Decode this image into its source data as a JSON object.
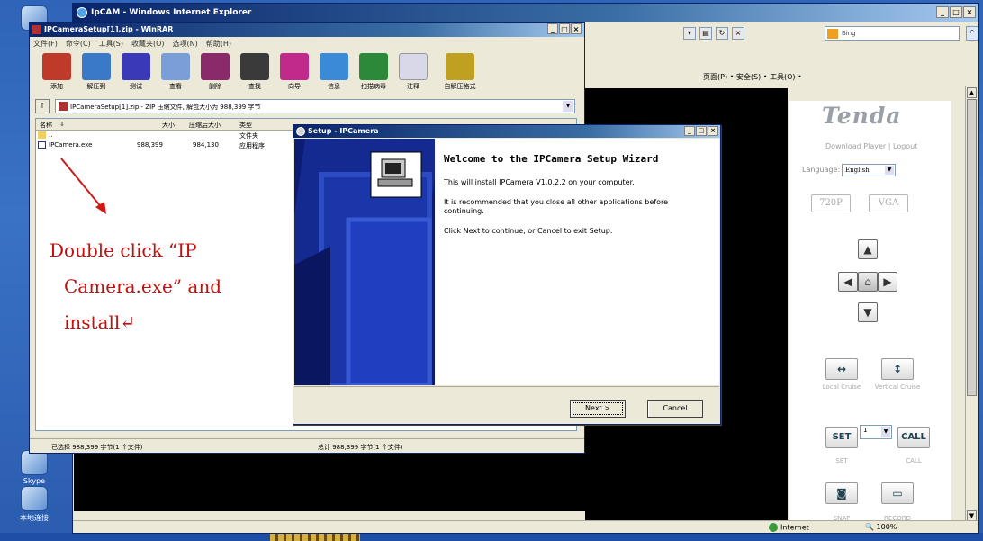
{
  "ie": {
    "title": "IpCAM - Windows Internet Explorer",
    "search_text": "Bing",
    "cmd_bar": "页面(P) • 安全(S) • 工具(O) • ",
    "status_zone": "Internet",
    "status_zoom": "100%"
  },
  "tenda": {
    "logo": "Tenda",
    "download_player": "Download Player",
    "logout": "Logout",
    "language_label": "Language:",
    "language_value": "English",
    "res_720p": "720P",
    "res_vga": "VGA",
    "local_cruise": "Local Cruise",
    "vertical_cruise": "Vertical Cruise",
    "set_label": "SET",
    "set_caption": "SET",
    "preset_value": "1",
    "call_label": "CALL",
    "call_caption": "CALL",
    "snap_caption": "SNAP",
    "record_caption": "RECORD"
  },
  "rar": {
    "title": "IPCameraSetup[1].zip - WinRAR",
    "menu": [
      "文件(F)",
      "命令(C)",
      "工具(S)",
      "收藏夹(O)",
      "选项(N)",
      "帮助(H)"
    ],
    "tools": [
      {
        "label": "添加",
        "color": "#c03a2a"
      },
      {
        "label": "解压到",
        "color": "#3a78c8"
      },
      {
        "label": "测试",
        "color": "#3a3ab8"
      },
      {
        "label": "查看",
        "color": "#7a9ed8"
      },
      {
        "label": "删除",
        "color": "#8a2a6a"
      },
      {
        "label": "查找",
        "color": "#3a3a3a"
      },
      {
        "label": "向导",
        "color": "#c02a8a"
      },
      {
        "label": "信息",
        "color": "#3a8ad8"
      },
      {
        "label": "扫描病毒",
        "color": "#2a8a3a"
      },
      {
        "label": "注释",
        "color": "#d8d8e8"
      },
      {
        "label": "自解压格式",
        "color": "#c0a020"
      }
    ],
    "path": "IPCameraSetup[1].zip - ZIP 压缩文件, 解包大小为 988,399 字节",
    "col_name": "名称",
    "col_size": "大小",
    "col_packed": "压缩后大小",
    "col_type": "类型",
    "rows": [
      {
        "name": "..",
        "size": "",
        "packed": "",
        "type": "文件夹"
      },
      {
        "name": "IPCamera.exe",
        "size": "988,399",
        "packed": "984,130",
        "type": "应用程序"
      }
    ],
    "status_left": "已选择 988,399 字节(1 个文件)",
    "status_right": "总计 988,399 字节(1 个文件)"
  },
  "annotation": {
    "line1": "Double click “IP",
    "line2": "Camera.exe” and",
    "line3": "install↵"
  },
  "setup": {
    "title": "Setup - IPCamera",
    "heading": "Welcome to the IPCamera Setup Wizard",
    "p1": "This will install IPCamera V1.0.2.2 on your computer.",
    "p2": "It is recommended that you close all other applications before continuing.",
    "p3": "Click Next to continue, or Cancel to exit Setup.",
    "next_label": "Next >",
    "cancel_label": "Cancel"
  },
  "desktop": {
    "icons": [
      "",
      "",
      "Skype",
      "",
      "本地连接"
    ]
  }
}
